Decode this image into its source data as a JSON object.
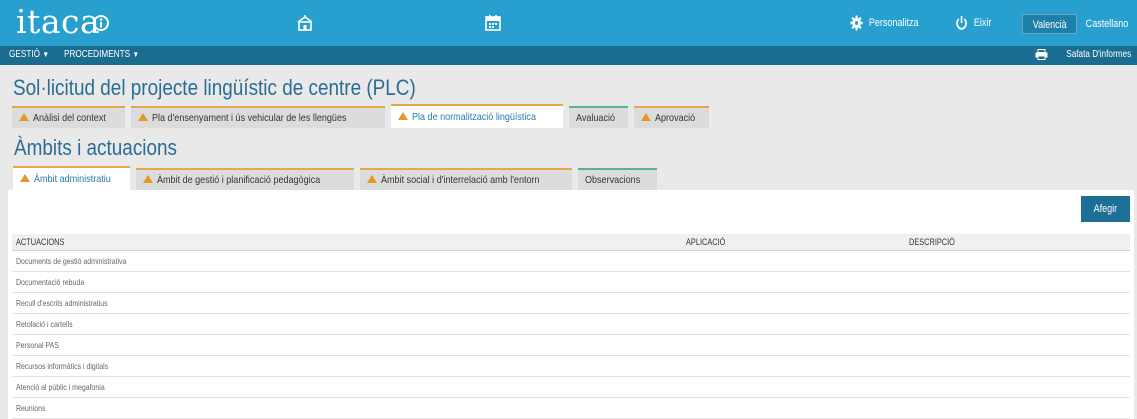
{
  "app": {
    "logo": "itaca",
    "personalitza": "Personalitza",
    "eixir": "Eixir",
    "lang_valencia": "Valencià",
    "lang_castellano": "Castellano"
  },
  "nav": {
    "gestio": "GESTIÓ",
    "procediments": "PROCEDIMENTS",
    "safata": "Safata D'informes"
  },
  "page": {
    "title": "Sol·licitud del projecte lingüístic de centre (PLC)",
    "section_title": "Àmbits i actuacions"
  },
  "main_tabs": [
    {
      "label": "Anàlisi del context"
    },
    {
      "label": "Pla d'ensenyament i ús vehicular de les llengües"
    },
    {
      "label": "Pla de normalització lingüística"
    },
    {
      "label": "Avaluació"
    },
    {
      "label": "Aprovació"
    }
  ],
  "sub_tabs": [
    {
      "label": "Àmbit administratiu"
    },
    {
      "label": "Àmbit de gestió i planificació pedagògica"
    },
    {
      "label": "Àmbit social i d'interrelació amb l'entorn"
    },
    {
      "label": "Observacions"
    }
  ],
  "buttons": {
    "afegir": "Afegir"
  },
  "table": {
    "headers": [
      "ACTUACIONS",
      "APLICACIÓ",
      "DESCRIPCIÓ"
    ],
    "rows": [
      "Documents de gestió administrativa",
      "Documentació rebuda",
      "Recull d'escrits administratius",
      "Retolació i cartells",
      "Personal PAS",
      "Recursos informàtics i digitals",
      "Atenció al públic i megafonia",
      "Reunions"
    ]
  },
  "colors": {
    "topbar": "#28a0cf",
    "navbar": "#1a6d91",
    "title": "#2a6d96",
    "warning": "#e8952a",
    "button": "#1e6f96"
  }
}
